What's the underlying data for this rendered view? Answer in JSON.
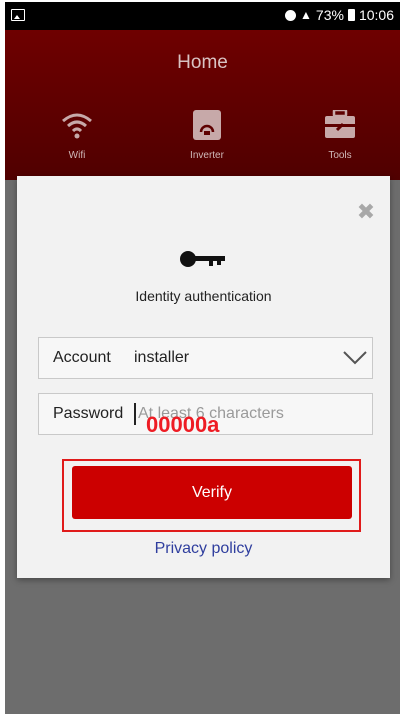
{
  "statusbar": {
    "battery": "73%",
    "time": "10:06"
  },
  "header": {
    "title": "Home"
  },
  "nav": {
    "items": [
      {
        "label": "Wifi",
        "icon": "wifi-icon"
      },
      {
        "label": "Inverter",
        "icon": "inverter-icon"
      },
      {
        "label": "Tools",
        "icon": "toolbox-icon"
      }
    ]
  },
  "dialog": {
    "title": "Identity authentication",
    "key_icon": "key-icon",
    "close_icon": "close-icon",
    "account": {
      "label": "Account",
      "value": "installer"
    },
    "password": {
      "label": "Password",
      "placeholder": "At least 6 characters",
      "typed": "00000a"
    },
    "verify_label": "Verify",
    "privacy_label": "Privacy policy"
  },
  "colors": {
    "header_bg": "#5e0000",
    "verify_bg": "#cc0000",
    "annotation": "#ee1c24",
    "link": "#2f3e9e"
  }
}
